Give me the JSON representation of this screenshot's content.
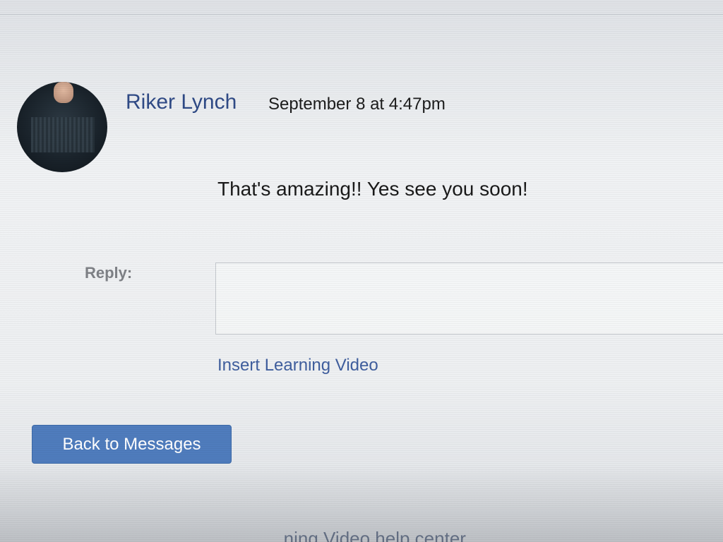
{
  "message": {
    "author": "Riker Lynch",
    "timestamp": "September 8 at 4:47pm",
    "body": "That's amazing!! Yes see you soon!"
  },
  "reply": {
    "label": "Reply:",
    "value": "",
    "placeholder": ""
  },
  "actions": {
    "insert_video_label": "Insert Learning Video",
    "back_label": "Back to Messages"
  },
  "footer": {
    "partial_text": "...ning Video help center"
  },
  "colors": {
    "author_link": "#2f4a86",
    "link": "#3f5e9e",
    "button_bg": "#4f7cbd",
    "muted_label": "#7e8186"
  },
  "icons": {
    "avatar": "profile-photo"
  }
}
